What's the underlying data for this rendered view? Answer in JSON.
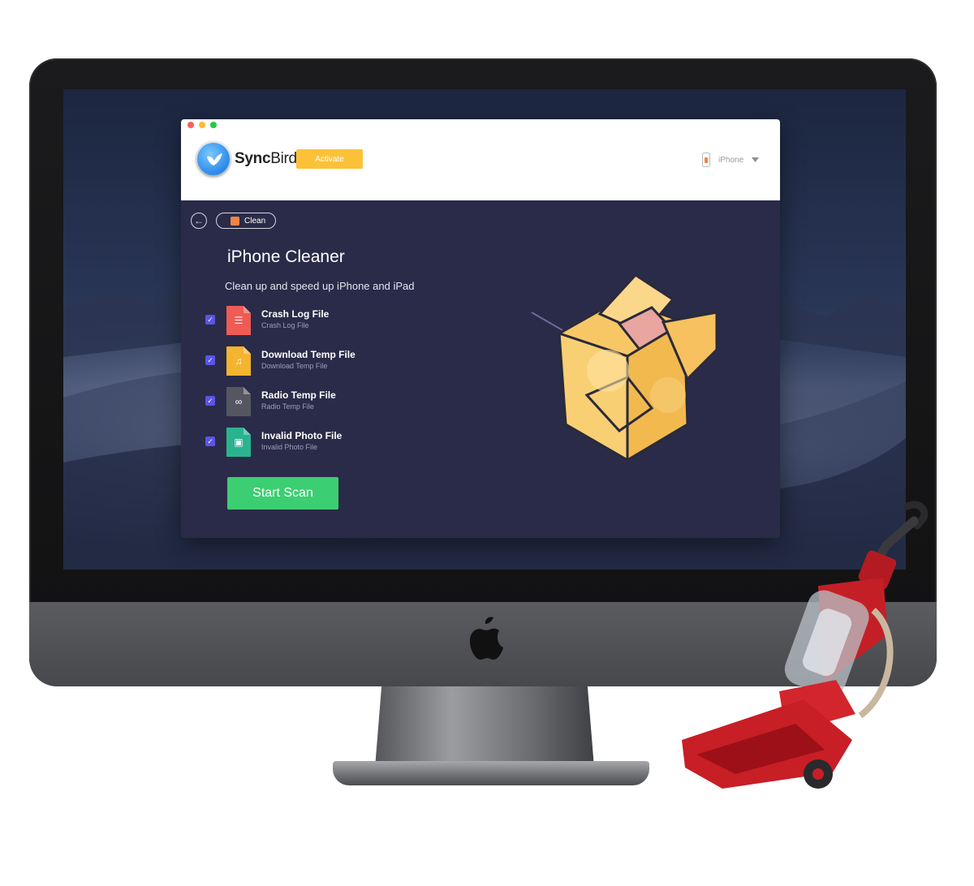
{
  "app": {
    "brand_part1": "Sync",
    "brand_part2": "Bird",
    "activate_label": "Activate",
    "device_label": "iPhone"
  },
  "breadcrumb": {
    "label": "Clean"
  },
  "main": {
    "title": "iPhone Cleaner",
    "subtitle": "Clean up and speed up iPhone and iPad",
    "items": [
      {
        "name": "Crash Log File",
        "sub": "Crash Log File",
        "checked": true,
        "icon": "list-file-icon",
        "color": "#ef5b55"
      },
      {
        "name": "Download Temp File",
        "sub": "Download Temp File",
        "checked": true,
        "icon": "music-file-icon",
        "color": "#f4b430"
      },
      {
        "name": "Radio Temp File",
        "sub": "Radio Temp File",
        "checked": true,
        "icon": "infinity-file-icon",
        "color": "#55565f"
      },
      {
        "name": "Invalid Photo File",
        "sub": "Invalid Photo File",
        "checked": true,
        "icon": "photo-file-icon",
        "color": "#2bb38f"
      }
    ],
    "scan_label": "Start Scan"
  },
  "colors": {
    "content_bg": "#2a2b48",
    "accent_green": "#3cce72",
    "activate_yellow": "#fbc239",
    "checkbox_blue": "#5a55e6"
  }
}
